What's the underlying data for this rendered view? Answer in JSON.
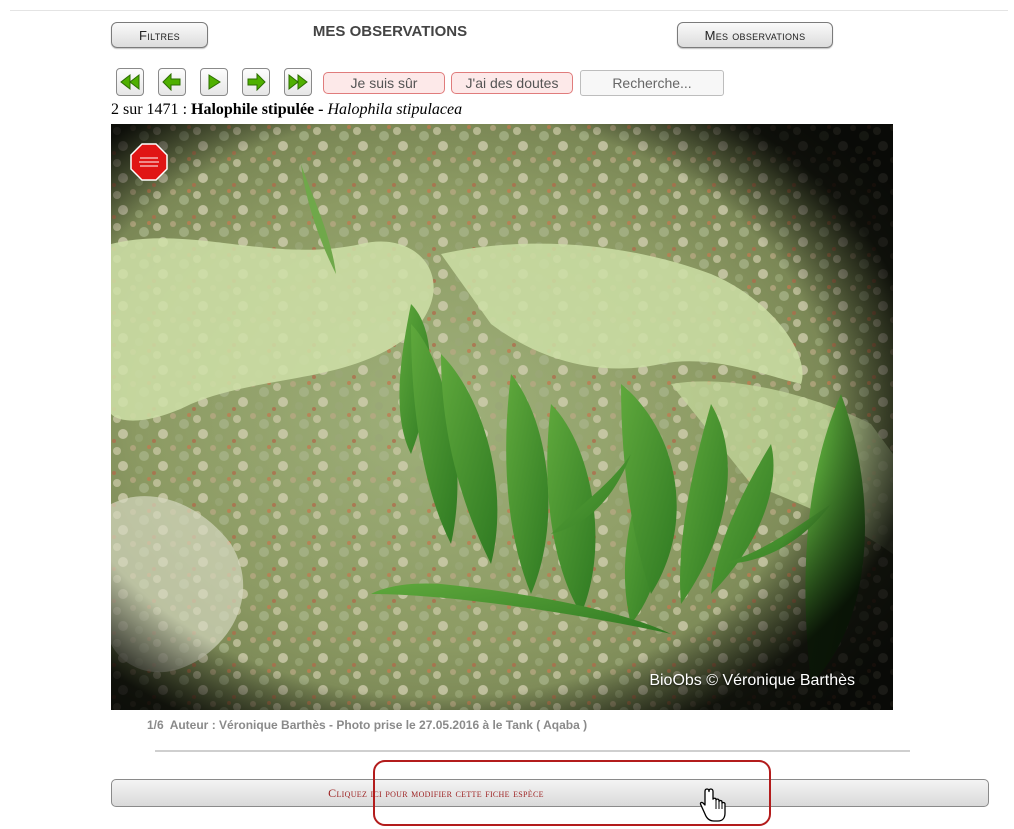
{
  "header": {
    "filters_label": "Filtres",
    "title": "MES OBSERVATIONS",
    "my_observations_label": "Mes observations"
  },
  "toolbar": {
    "sure_label": "Je suis sûr",
    "doubts_label": "J'ai des doutes",
    "search_placeholder": "Recherche..."
  },
  "record": {
    "position": "2 sur 1471",
    "separator": ":",
    "common_name": "Halophile stipulée",
    "dash": "-",
    "scientific_name": "Halophila stipulacea"
  },
  "photo": {
    "watermark": "BioObs © Véronique Barthès",
    "index": "1/6",
    "credit": "Auteur : Véronique Barthès - Photo prise le 27.05.2016 à le Tank ( Aqaba )"
  },
  "edit": {
    "label": "Cliquez ici pour modifier cette fiche espèce"
  },
  "colors": {
    "accent": "#b31c1c",
    "nav_green": "#43a400",
    "pink_button": "#fde9e9"
  },
  "icons": [
    "first-page-icon",
    "previous-icon",
    "play-icon",
    "next-icon",
    "last-page-icon",
    "hand-pointer-icon",
    "stop-badge-icon"
  ]
}
